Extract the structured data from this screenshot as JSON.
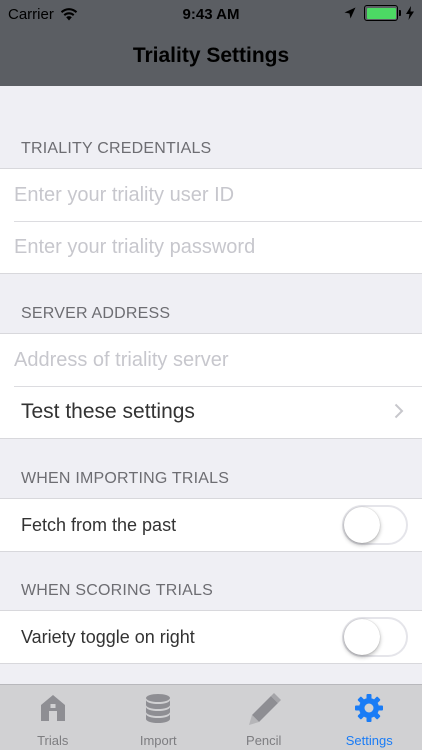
{
  "status_bar": {
    "carrier": "Carrier",
    "time": "9:43 AM"
  },
  "nav": {
    "title": "Triality Settings"
  },
  "sections": {
    "credentials": {
      "header": "TRIALITY CREDENTIALS",
      "user_id_placeholder": "Enter your triality user ID",
      "password_placeholder": "Enter your triality password"
    },
    "server": {
      "header": "SERVER ADDRESS",
      "address_placeholder": "Address of triality server",
      "test_label": "Test these settings"
    },
    "importing": {
      "header": "WHEN IMPORTING TRIALS",
      "fetch_label": "Fetch from the past",
      "fetch_on": false
    },
    "scoring": {
      "header": "WHEN SCORING TRIALS",
      "variety_label": "Variety toggle on right",
      "variety_on": false
    }
  },
  "tabs": [
    {
      "label": "Trials",
      "icon": "house-icon",
      "active": false
    },
    {
      "label": "Import",
      "icon": "database-icon",
      "active": false
    },
    {
      "label": "Pencil",
      "icon": "pencil-icon",
      "active": false
    },
    {
      "label": "Settings",
      "icon": "gear-icon",
      "active": true
    }
  ],
  "colors": {
    "nav_background": "#5b5e63",
    "accent": "#1a7cf6",
    "battery": "#4cd964"
  }
}
